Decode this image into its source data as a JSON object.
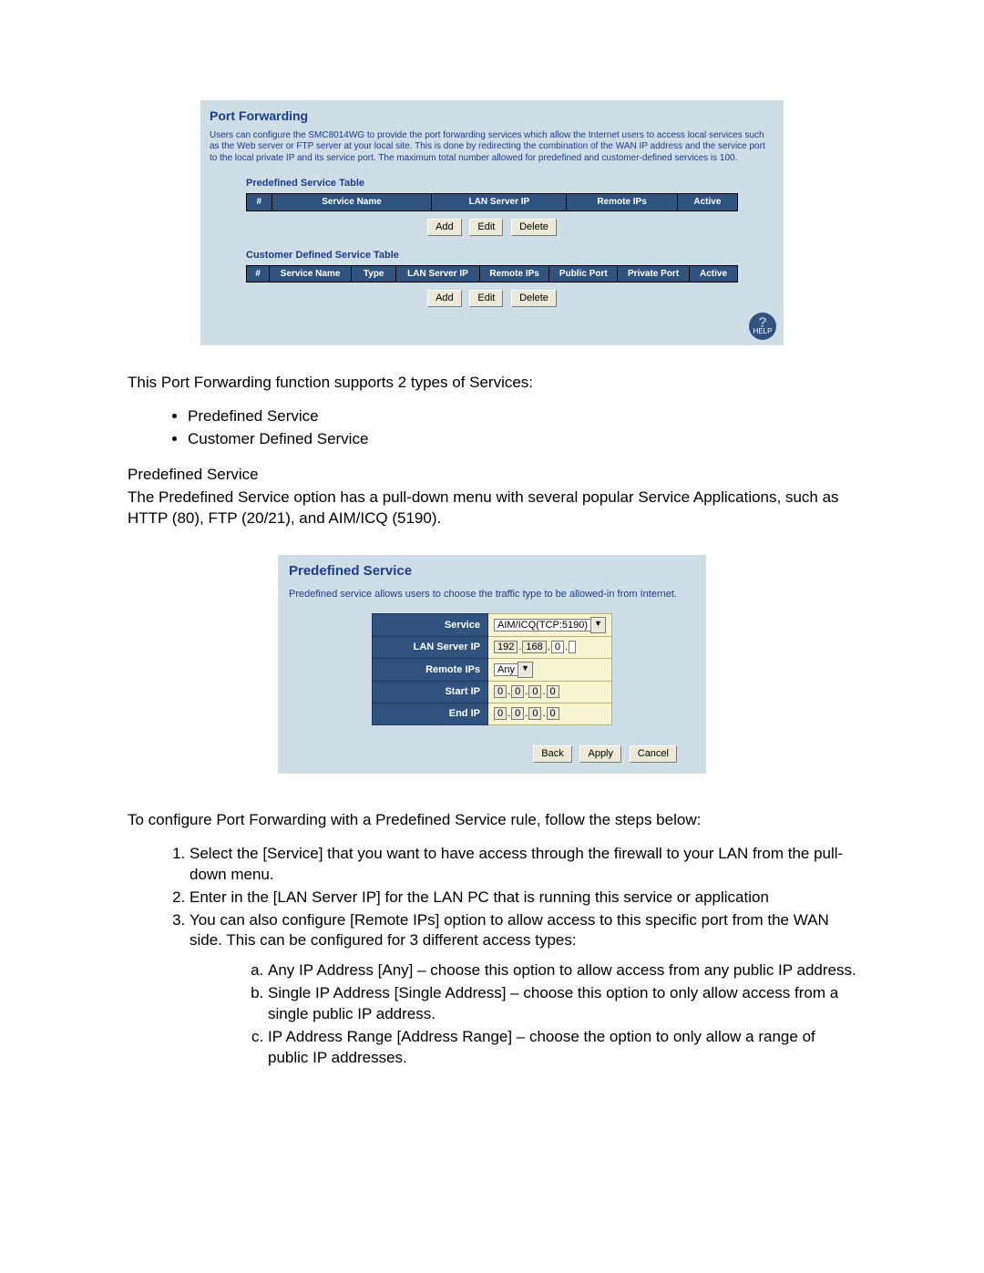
{
  "ss1": {
    "title": "Port Forwarding",
    "desc": "Users can configure the SMC8014WG to provide the port forwarding services which allow the Internet users to access local services such as the Web server or FTP server at your local site. This is done by redirecting the combination of the WAN IP address and the service port to the local private IP and its service port. The maximum total number allowed for predefined and customer-defined services is 100.",
    "predef_title": "Predefined Service Table",
    "predef_headers": {
      "num": "#",
      "name": "Service Name",
      "lan": "LAN Server IP",
      "remote": "Remote IPs",
      "active": "Active"
    },
    "cust_title": "Customer Defined Service Table",
    "cust_headers": {
      "num": "#",
      "name": "Service Name",
      "type": "Type",
      "lan": "LAN Server IP",
      "remote": "Remote IPs",
      "pub": "Public Port",
      "priv": "Private Port",
      "active": "Active"
    },
    "buttons": {
      "add": "Add",
      "edit": "Edit",
      "delete": "Delete"
    },
    "help": "HELP"
  },
  "text": {
    "intro": "This Port Forwarding function supports 2 types of Services:",
    "b1": "Predefined Service",
    "b2": "Customer Defined Service",
    "predef_head": "Predefined Service",
    "predef_para": "The Predefined Service option has a pull-down menu with several popular Service Applications, such as HTTP (80), FTP (20/21), and AIM/ICQ (5190).",
    "config_intro": "To configure Port Forwarding with a Predefined Service rule, follow the steps below:",
    "step1": "Select the [Service] that you want to have access through the firewall to your LAN from the pull-down menu.",
    "step2": "Enter in the [LAN Server IP] for the LAN PC that is running this service or application",
    "step3": "You can also configure [Remote IPs] option to allow access to this specific port from the WAN side.  This can be configured for 3 different access types:",
    "sa": "Any IP Address [Any] – choose this option to allow access from any public IP address.",
    "sb": "Single IP Address [Single Address] – choose this option to only allow access from a single public IP address.",
    "sc": "IP Address Range [Address Range] – choose the option to only allow a range of public IP addresses."
  },
  "ss2": {
    "title": "Predefined Service",
    "desc": "Predefined service allows users to choose the traffic type to be allowed-in from Internet.",
    "labels": {
      "service": "Service",
      "lan": "LAN Server IP",
      "remote": "Remote IPs",
      "start": "Start IP",
      "end": "End IP"
    },
    "service_value": "AIM/ICQ(TCP:5190)",
    "remote_value": "Any",
    "lan_octets": [
      "192",
      "168",
      "0",
      ""
    ],
    "start_octets": [
      "0",
      "0",
      "0",
      "0"
    ],
    "end_octets": [
      "0",
      "0",
      "0",
      "0"
    ],
    "buttons": {
      "back": "Back",
      "apply": "Apply",
      "cancel": "Cancel"
    }
  }
}
